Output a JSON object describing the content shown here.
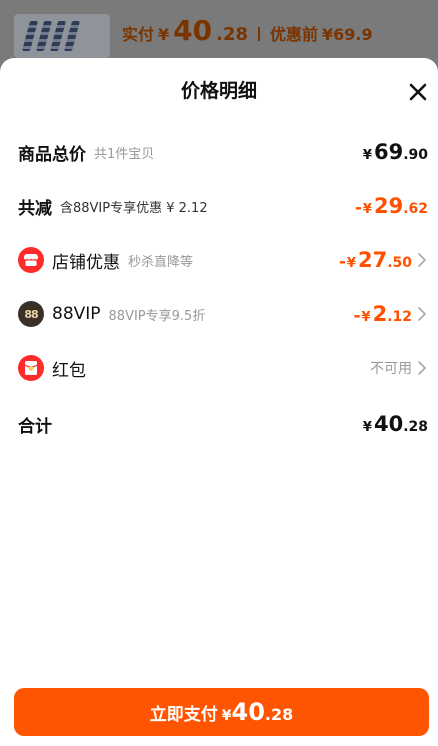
{
  "background": {
    "actual_label": "实付",
    "actual_yen": "¥",
    "actual_int": "40",
    "actual_dec": ".28",
    "before_label": "优惠前",
    "before_price": "¥69.9"
  },
  "sheet": {
    "title": "价格明细",
    "close_icon": "close-icon"
  },
  "rows": {
    "total": {
      "label": "商品总价",
      "sub": "共1件宝贝",
      "yen": "¥",
      "int": "69",
      "dec": ".90"
    },
    "reduce": {
      "label": "共减",
      "sub": "含88VIP专享优惠 ¥ 2.12",
      "minus": "-",
      "yen": "¥",
      "int": "29",
      "dec": ".62"
    },
    "store": {
      "label": "店铺优惠",
      "sub": "秒杀直降等",
      "minus": "-",
      "yen": "¥",
      "int": "27",
      "dec": ".50",
      "icon": "store-icon"
    },
    "vip": {
      "label": "88VIP",
      "sub": "88VIP专享9.5折",
      "minus": "-",
      "yen": "¥",
      "int": "2",
      "dec": ".12",
      "icon_text": "88"
    },
    "redpacket": {
      "label": "红包",
      "status": "不可用",
      "icon": "red-packet-icon"
    },
    "sum": {
      "label": "合计",
      "yen": "¥",
      "int": "40",
      "dec": ".28"
    }
  },
  "pay_button": {
    "label": "立即支付",
    "yen": "¥",
    "int": "40",
    "dec": ".28"
  },
  "colors": {
    "accent": "#ff5000",
    "button": "#ff5500",
    "red_icon": "#ff2a2a"
  }
}
